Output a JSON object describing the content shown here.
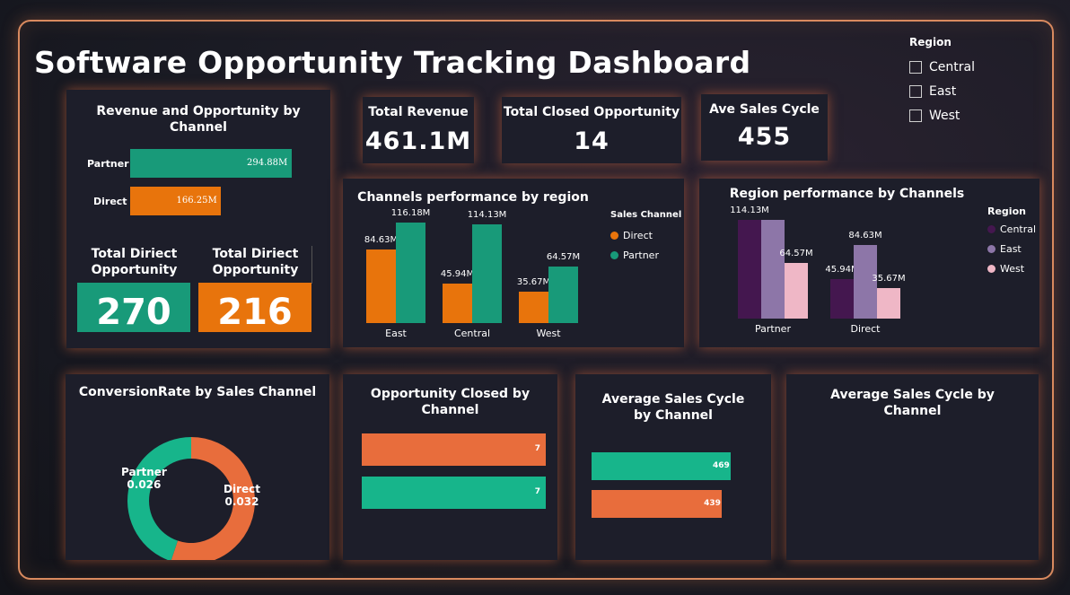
{
  "title": "Software Opportunity Tracking Dashboard",
  "colors": {
    "direct": "#e8740c",
    "partner": "#189a79",
    "central": "#44174f",
    "east": "#8d76a8",
    "west": "#efb7c6",
    "donut_direct": "#e86d3c",
    "donut_partner": "#17b58b",
    "closed_bar": "#e86d3c",
    "closed_bar2": "#17b58b"
  },
  "slicer": {
    "title": "Region",
    "items": [
      "Central",
      "East",
      "West"
    ]
  },
  "kpis": {
    "total_revenue": {
      "label": "Total Revenue",
      "value": "461.1M"
    },
    "total_closed": {
      "label": "Total Closed Opportunity",
      "value": "14"
    },
    "ave_cycle": {
      "label": "Ave Sales Cycle",
      "value": "455"
    }
  },
  "rev_by_channel": {
    "title": "Revenue and Opportunity by Channel",
    "chart_data": {
      "type": "bar",
      "categories": [
        "Partner",
        "Direct"
      ],
      "values": [
        294.88,
        166.25
      ],
      "value_labels": [
        "294.88M",
        "166.25M"
      ]
    },
    "direct_opp": {
      "label": "Total Diriect Opportunity",
      "value": "270"
    },
    "partner_opp": {
      "label": "Total Diriect Opportunity",
      "value": "216"
    }
  },
  "channels_by_region": {
    "title": "Channels performance by region",
    "legend_title": "Sales Channel",
    "chart_data": {
      "type": "bar",
      "categories": [
        "East",
        "Central",
        "West"
      ],
      "series": [
        {
          "name": "Direct",
          "values": [
            84.63,
            45.94,
            35.67
          ],
          "labels": [
            "84.63M",
            "45.94M",
            "35.67M"
          ]
        },
        {
          "name": "Partner",
          "values": [
            116.18,
            114.13,
            64.57
          ],
          "labels": [
            "116.18M",
            "114.13M",
            "64.57M"
          ]
        }
      ]
    }
  },
  "region_by_channels": {
    "title": "Region performance by Channels",
    "legend_title": "Region",
    "chart_data": {
      "type": "bar",
      "categories": [
        "Partner",
        "Direct"
      ],
      "series": [
        {
          "name": "Central",
          "values": [
            114.13,
            45.94
          ],
          "labels": [
            "114.13M",
            "45.94M"
          ]
        },
        {
          "name": "East",
          "values": [
            114.13,
            84.63
          ],
          "labels": [
            "",
            "84.63M"
          ]
        },
        {
          "name": "West",
          "values": [
            64.57,
            35.67
          ],
          "labels": [
            "64.57M",
            "35.67M"
          ]
        }
      ]
    }
  },
  "conversion": {
    "title": "ConversionRate by Sales Channel",
    "chart_data": {
      "type": "pie",
      "categories": [
        "Direct",
        "Partner"
      ],
      "values": [
        0.032,
        0.026
      ],
      "labels": [
        "0.032",
        "0.026"
      ]
    }
  },
  "closed_by_channel": {
    "title": "Opportunity Closed by Channel",
    "chart_data": {
      "type": "bar",
      "values": [
        7,
        7
      ],
      "labels": [
        "7",
        "7"
      ]
    }
  },
  "avg_cycle": {
    "title": "Average Sales Cycle by Channel",
    "chart_data": {
      "type": "bar",
      "values": [
        469,
        439
      ],
      "labels": [
        "469",
        "439"
      ]
    }
  },
  "avg_cycle_empty": {
    "title": "Average Sales Cycle by Channel"
  }
}
